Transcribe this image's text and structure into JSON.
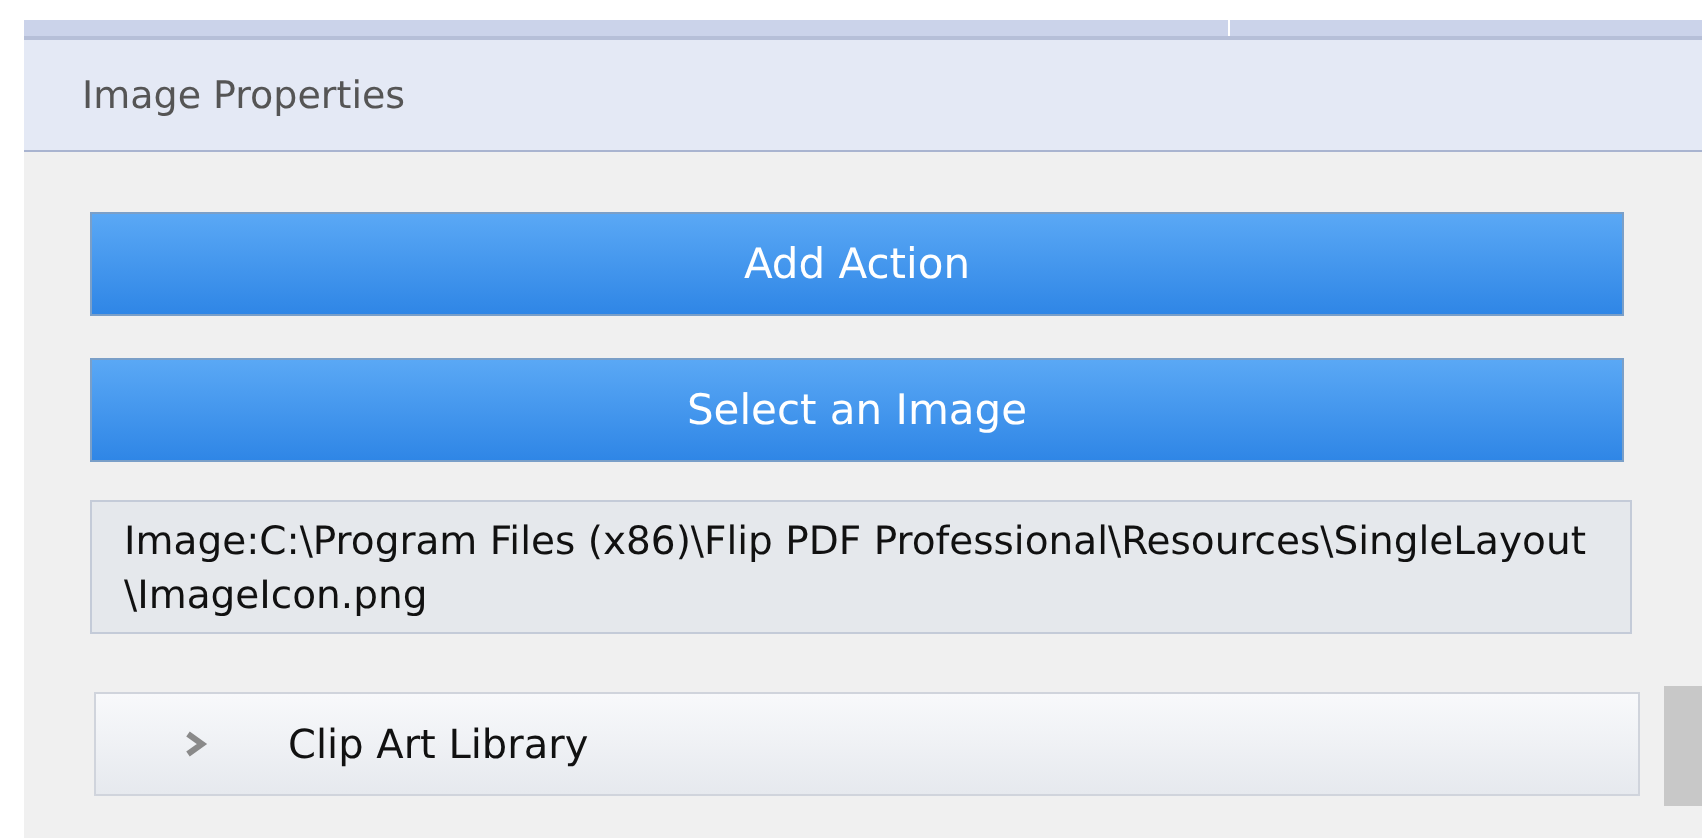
{
  "panel": {
    "title": "Image Properties"
  },
  "buttons": [
    "Add Action",
    "Select an Image"
  ],
  "image_path": "Image:C:\\Program Files (x86)\\Flip PDF Professional\\Resources\\SingleLayout\\ImageIcon.png",
  "sections": [
    {
      "label": "Clip Art Library",
      "expanded": false
    }
  ]
}
